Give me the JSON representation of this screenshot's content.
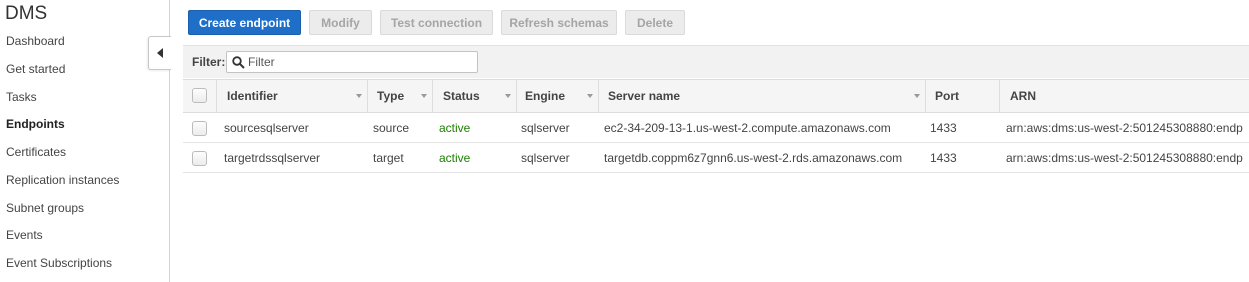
{
  "sidebar": {
    "title": "DMS",
    "items": [
      {
        "label": "Dashboard"
      },
      {
        "label": "Get started"
      },
      {
        "label": "Tasks"
      },
      {
        "label": "Endpoints",
        "active": true
      },
      {
        "label": "Certificates"
      },
      {
        "label": "Replication instances"
      },
      {
        "label": "Subnet groups"
      },
      {
        "label": "Events"
      },
      {
        "label": "Event Subscriptions"
      }
    ]
  },
  "toolbar": {
    "create_label": "Create endpoint",
    "modify_label": "Modify",
    "test_label": "Test connection",
    "refresh_label": "Refresh schemas",
    "delete_label": "Delete"
  },
  "filter": {
    "label": "Filter:",
    "placeholder": "Filter",
    "value": ""
  },
  "table": {
    "columns": [
      "Identifier",
      "Type",
      "Status",
      "Engine",
      "Server name",
      "Port",
      "ARN"
    ],
    "rows": [
      {
        "identifier": "sourcesqlserver",
        "type": "source",
        "status": "active",
        "engine": "sqlserver",
        "server_name": "ec2-34-209-13-1.us-west-2.compute.amazonaws.com",
        "port": "1433",
        "arn": "arn:aws:dms:us-west-2:501245308880:endp"
      },
      {
        "identifier": "targetrdssqlserver",
        "type": "target",
        "status": "active",
        "engine": "sqlserver",
        "server_name": "targetdb.coppm6z7gnn6.us-west-2.rds.amazonaws.com",
        "port": "1433",
        "arn": "arn:aws:dms:us-west-2:501245308880:endp"
      }
    ]
  },
  "colors": {
    "primary_button": "#1f6fc9",
    "status_active": "#1d8102"
  }
}
